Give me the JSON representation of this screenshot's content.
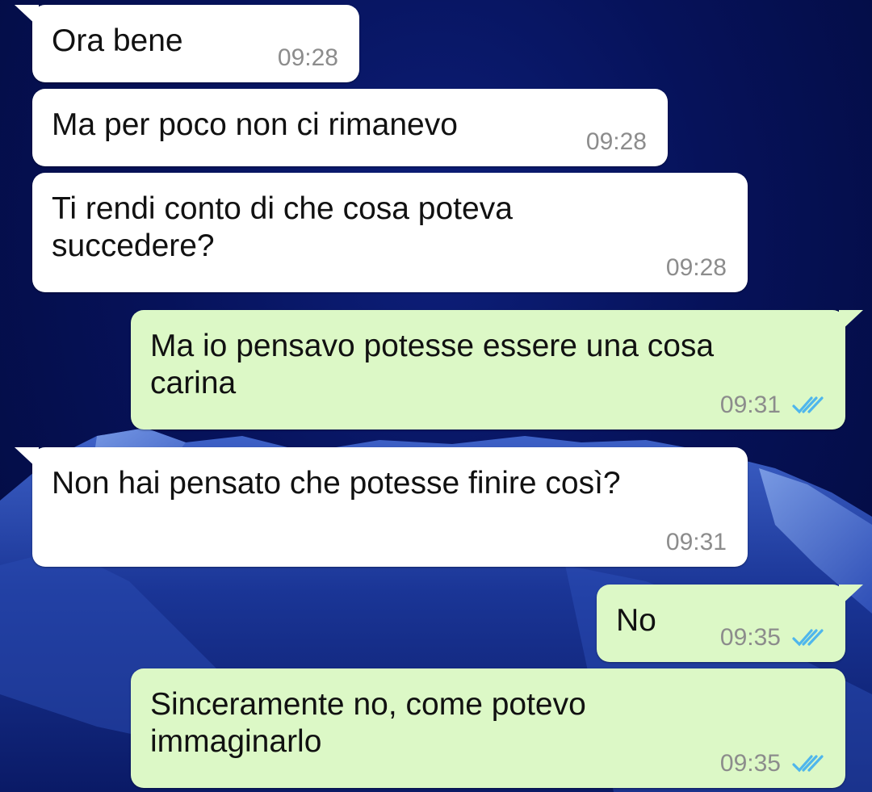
{
  "theme": {
    "incoming_bg": "#ffffff",
    "outgoing_bg": "#dcf8c6",
    "read_tick_color": "#4fb6ec",
    "time_color": "#8c8c8c"
  },
  "messages": [
    {
      "direction": "incoming",
      "text": "Ora bene",
      "time": "09:28"
    },
    {
      "direction": "incoming",
      "text": "Ma per poco non ci rimanevo",
      "time": "09:28"
    },
    {
      "direction": "incoming",
      "text": "Ti rendi conto di che cosa poteva succedere?",
      "time": "09:28"
    },
    {
      "direction": "outgoing",
      "text": "Ma io pensavo potesse essere una cosa carina",
      "time": "09:31",
      "status": "read-double-check-icon"
    },
    {
      "direction": "incoming",
      "text": "Non hai pensato che potesse finire così?",
      "time": "09:31"
    },
    {
      "direction": "outgoing",
      "text": "No",
      "time": "09:35",
      "status": "read-double-check-icon"
    },
    {
      "direction": "outgoing",
      "text": "Sinceramente no, come potevo immaginarlo",
      "time": "09:35",
      "status": "read-double-check-icon"
    }
  ]
}
